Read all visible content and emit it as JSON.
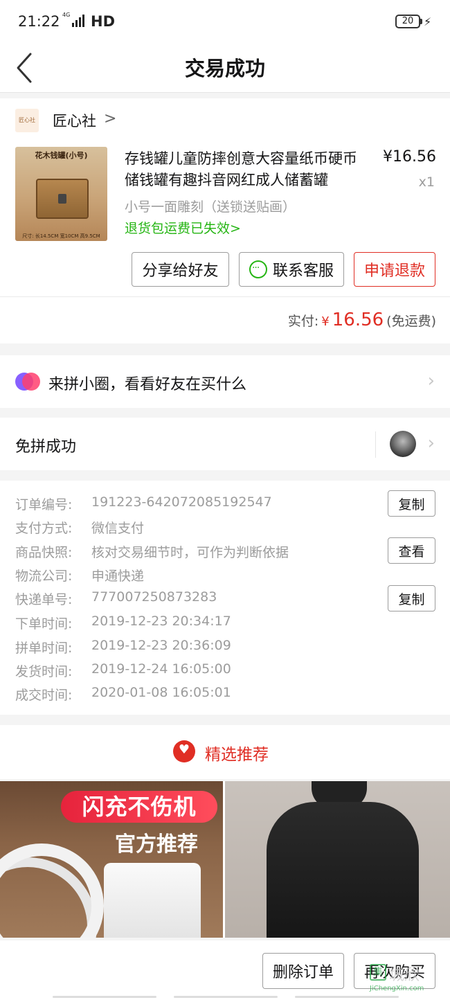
{
  "status_bar": {
    "time": "21:22",
    "network": "4G",
    "hd": "HD",
    "battery": "20"
  },
  "nav": {
    "title": "交易成功"
  },
  "shop": {
    "logo_text": "匠心社",
    "name": "匠心社",
    "chevron": ">"
  },
  "product": {
    "image_label": "花木钱罐(小号)",
    "image_footer": "尺寸: 长14.5CM 宽10CM 高9.5CM",
    "title": "存钱罐儿童防摔创意大容量纸币硬币储钱罐有趣抖音网红成人储蓄罐",
    "price": "¥16.56",
    "quantity": "x1",
    "spec": "小号一面雕刻（送锁送贴画）",
    "return_note": "退货包运费已失效>"
  },
  "actions": {
    "share": "分享给好友",
    "contact": "联系客服",
    "refund": "申请退款"
  },
  "payment": {
    "label": "实付:",
    "currency": "¥",
    "amount": "16.56",
    "shipping": "(免运费)"
  },
  "circle": {
    "text": "来拼小圈，看看好友在买什么"
  },
  "group": {
    "text": "免拼成功"
  },
  "order_info": [
    {
      "label": "订单编号:",
      "value": "191223-642072085192547",
      "button": "复制"
    },
    {
      "label": "支付方式:",
      "value": "微信支付"
    },
    {
      "label": "商品快照:",
      "value": "核对交易细节时，可作为判断依据",
      "button": "查看"
    },
    {
      "label": "物流公司:",
      "value": "申通快递"
    },
    {
      "label": "快递单号:",
      "value": "777007250873283",
      "button": "复制"
    },
    {
      "label": "下单时间:",
      "value": "2019-12-23 20:34:17"
    },
    {
      "label": "拼单时间:",
      "value": "2019-12-23 20:36:09"
    },
    {
      "label": "发货时间:",
      "value": "2019-12-24 16:05:00"
    },
    {
      "label": "成交时间:",
      "value": "2020-01-08 16:05:01"
    }
  ],
  "recommend": {
    "title": "精选推荐",
    "item1_promo_line1": "闪充不伤机",
    "item1_promo_line2": "官方推荐"
  },
  "bottom": {
    "delete": "删除订单",
    "rebuy": "再次购买"
  },
  "watermark": {
    "text": "城欣",
    "domain": "JiChengXin.com"
  },
  "colors": {
    "accent": "#e02e24",
    "green": "#25b513"
  }
}
